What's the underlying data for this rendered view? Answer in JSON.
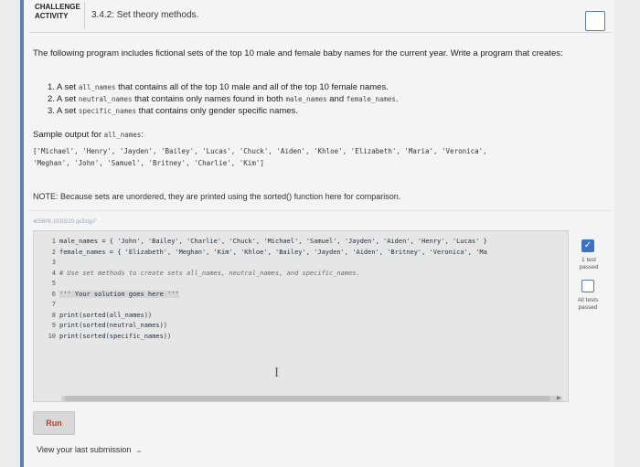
{
  "header": {
    "challenge_label": "CHALLENGE ACTIVITY",
    "title": "3.4.2: Set theory methods."
  },
  "intro": "The following program includes fictional sets of the top 10 male and female baby names for the current year. Write a program that creates:",
  "tasks": [
    {
      "prefix": "1. A set ",
      "code": "all_names",
      "suffix": " that contains all of the top 10 male and all of the top 10 female names."
    },
    {
      "prefix": "2. A set ",
      "code": "neutral_names",
      "suffix": " that contains only names found in both ",
      "code2": "male_names",
      "mid": " and ",
      "code3": "female_names",
      "end": "."
    },
    {
      "prefix": "3. A set ",
      "code": "specific_names",
      "suffix": " that contains only gender specific names."
    }
  ],
  "sample": {
    "label": "Sample output for ",
    "code": "all_names",
    "colon": ":",
    "line1": "['Michael', 'Henry', 'Jayden', 'Bailey', 'Lucas', 'Chuck', 'Aiden', 'Khloe', 'Elizabeth', 'Maria', 'Veronica',",
    "line2": "'Meghan', 'John', 'Samuel', 'Britney', 'Charlie', 'Kim']"
  },
  "note": "NOTE: Because sets are unordered, they are printed using the sorted() function here for comparison.",
  "lab_id": "405606.1030220.qx3zqy7",
  "editor": {
    "lines": [
      {
        "n": "1",
        "text": "male_names = { 'John', 'Bailey', 'Charlie', 'Chuck', 'Michael', 'Samuel', 'Jayden', 'Aiden', 'Henry', 'Lucas' }"
      },
      {
        "n": "2",
        "text": "female_names = { 'Elizabeth', 'Meghan', 'Kim', 'Khloe', 'Bailey', 'Jayden', 'Aiden', 'Britney', 'Veronica', 'Ma"
      },
      {
        "n": "3",
        "text": ""
      },
      {
        "n": "4",
        "text": "# Use set methods to create sets all_names, neutral_names, and specific_names."
      },
      {
        "n": "5",
        "text": ""
      },
      {
        "n": "6",
        "text": "''' Your solution goes here '''"
      },
      {
        "n": "7",
        "text": ""
      },
      {
        "n": "8",
        "text": "print(sorted(all_names))"
      },
      {
        "n": "9",
        "text": "print(sorted(neutral_names))"
      },
      {
        "n": "10",
        "text": "print(sorted(specific_names))"
      }
    ]
  },
  "tests": {
    "passed_label": "1 test passed",
    "all_label": "All tests passed"
  },
  "run_label": "Run",
  "view_submission": "View your last submission",
  "colors": {
    "accent": "#3a72c8",
    "run_text": "#c0392b"
  }
}
